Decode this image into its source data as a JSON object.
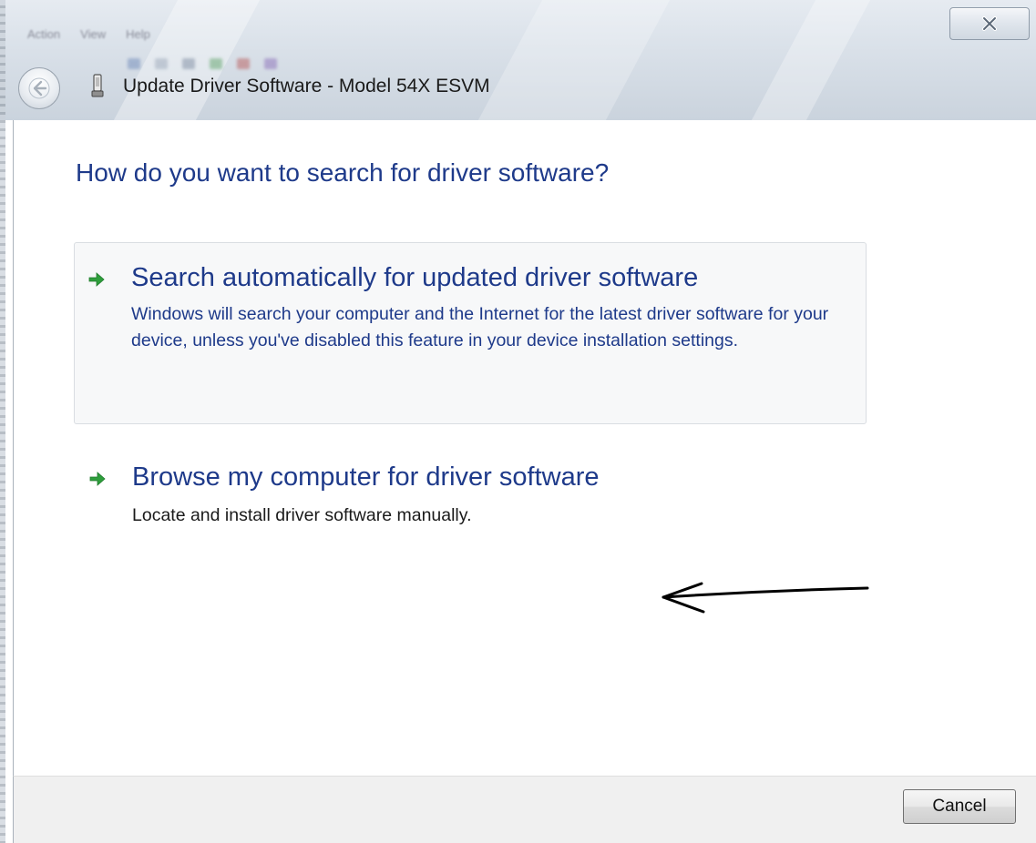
{
  "window": {
    "title": "Update Driver Software - Model 54X ESVM"
  },
  "background_window": {
    "menu": [
      "Action",
      "View",
      "Help"
    ]
  },
  "wizard": {
    "instruction": "How do you want to search for driver software?",
    "options": [
      {
        "title": "Search automatically for updated driver software",
        "description": "Windows will search your computer and the Internet for the latest driver software for your device, unless you've disabled this feature in your device installation settings."
      },
      {
        "title": "Browse my computer for driver software",
        "description": "Locate and install driver software manually."
      }
    ]
  },
  "footer": {
    "cancel_label": "Cancel"
  },
  "icons": {
    "close": "close-icon",
    "back": "back-arrow-icon",
    "device": "device-icon",
    "option_arrow": "green-arrow-icon",
    "annotation": "hand-drawn-arrow"
  },
  "colors": {
    "link_blue": "#1e3a8a",
    "arrow_green": "#2e9e3c",
    "footer_gray": "#f0f0f0"
  }
}
